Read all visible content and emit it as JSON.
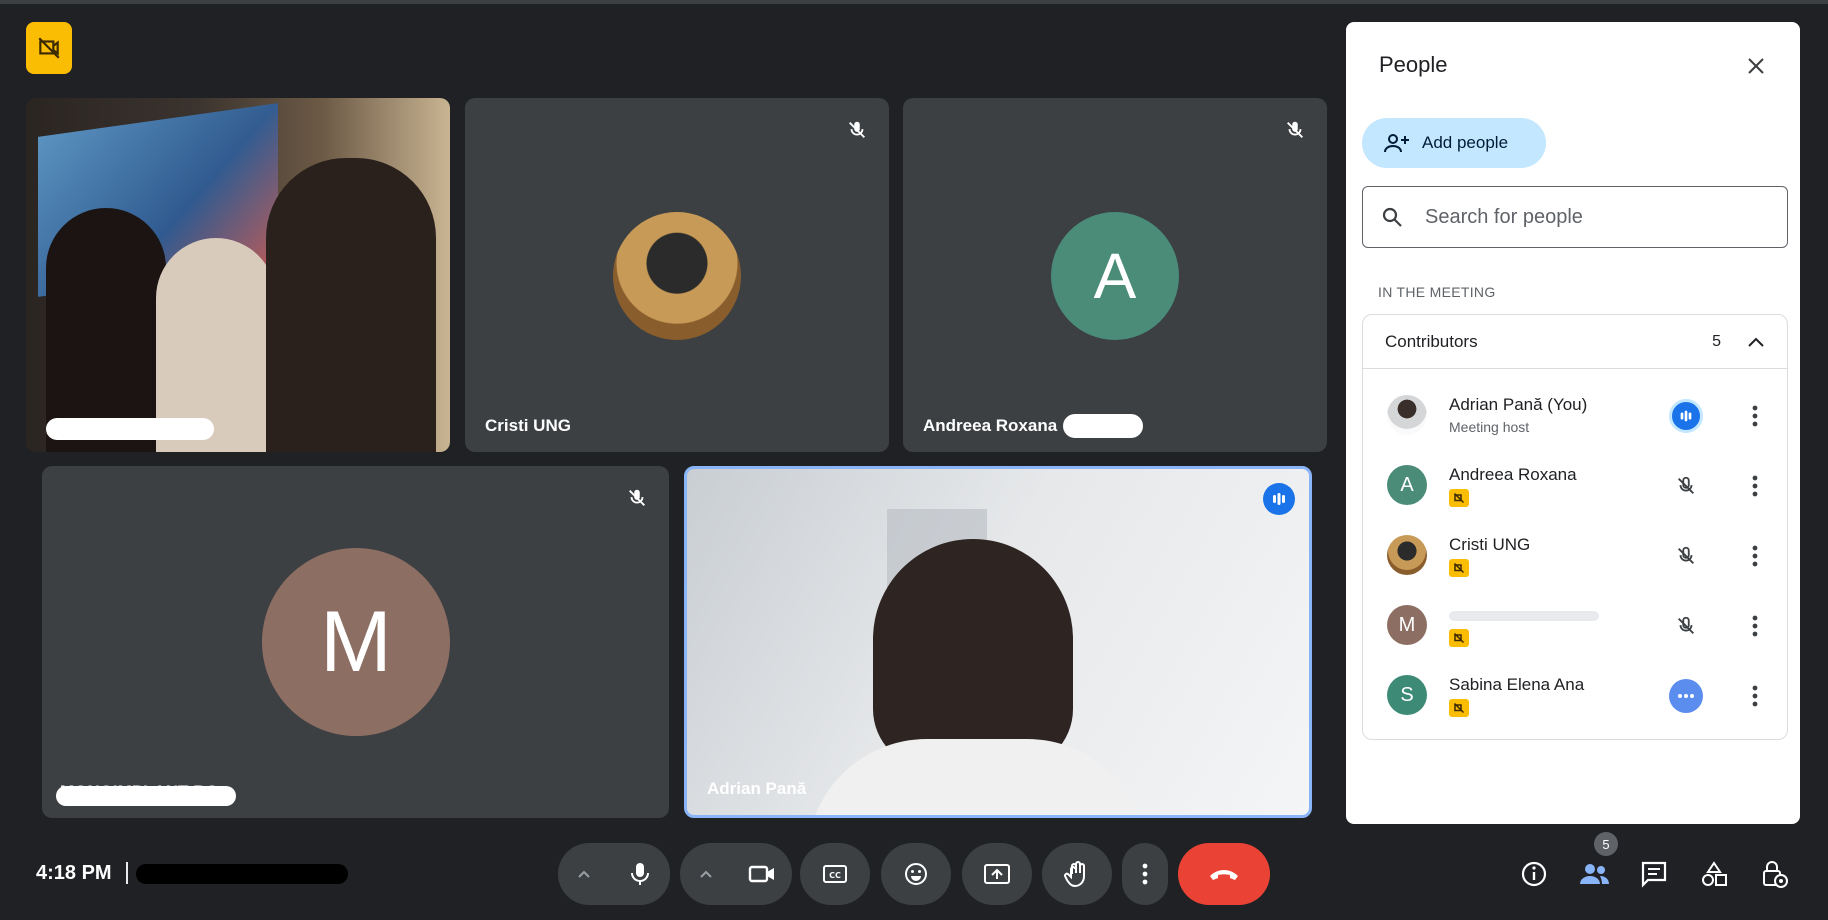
{
  "meeting": {
    "time": "4:18 PM",
    "participant_count": "5"
  },
  "tiles": [
    {
      "name": "",
      "kind": "photo-group"
    },
    {
      "name": "Cristi UNG",
      "kind": "avatar-photo",
      "muted": true
    },
    {
      "name": "Andreea Roxana",
      "kind": "initial",
      "initial": "A",
      "color": "#4a8c78",
      "muted": true
    },
    {
      "name": "MONOIMPLANT RO",
      "kind": "initial",
      "initial": "M",
      "color": "#8d6e63",
      "muted": true
    },
    {
      "name": "Adrian Pană",
      "kind": "photo-speaker",
      "speaking": true
    }
  ],
  "panel": {
    "title": "People",
    "add_label": "Add people",
    "search_placeholder": "Search for people",
    "section_label": "IN THE MEETING",
    "group_label": "Contributors",
    "group_count": "5",
    "people": [
      {
        "name": "Adrian Pană (You)",
        "sub": "Meeting host",
        "avatar": "photo",
        "status": "speaking"
      },
      {
        "name": "Andreea Roxana",
        "initial": "A",
        "color": "#4a8c78",
        "status": "muted"
      },
      {
        "name": "Cristi UNG",
        "avatar": "photo",
        "status": "muted"
      },
      {
        "name": "",
        "initial": "M",
        "color": "#8d6e63",
        "status": "muted"
      },
      {
        "name": "Sabina Elena Ana",
        "initial": "S",
        "color": "#3d8a77",
        "status": "more"
      }
    ]
  },
  "colors": {
    "accent_blue": "#1a73e8",
    "end_call_red": "#ea4335",
    "badge_yellow": "#fbbc04",
    "chip_blue": "#c2e7ff"
  },
  "icons": {
    "top_badge": "camera-off-icon",
    "tile_mute": "mic-off-icon",
    "speaking": "audio-level-icon",
    "controls": [
      "chevron-up-icon",
      "mic-icon",
      "chevron-up-icon",
      "camera-icon",
      "captions-icon",
      "emoji-icon",
      "present-icon",
      "raise-hand-icon",
      "more-vert-icon",
      "end-call-icon"
    ],
    "right": [
      "info-icon",
      "people-icon",
      "chat-icon",
      "activities-icon",
      "host-controls-icon"
    ]
  }
}
